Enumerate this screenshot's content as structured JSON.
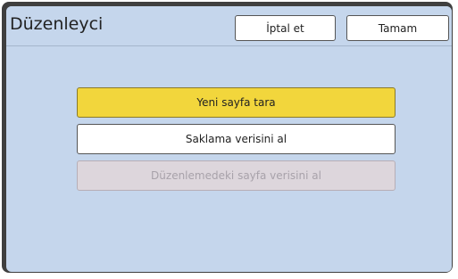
{
  "dialog": {
    "title": "Düzenleyci",
    "cancel_label": "İptal et",
    "ok_label": "Tamam"
  },
  "options": {
    "scan_new_page": "Yeni sayfa tara",
    "get_storage_data": "Saklama verisini al",
    "get_editing_page_data": "Düzenlemedeki sayfa verisini al"
  },
  "colors": {
    "panel_background": "#c5d6ec",
    "selected_option": "#f2d63c",
    "disabled_option": "#ddd6dc"
  }
}
